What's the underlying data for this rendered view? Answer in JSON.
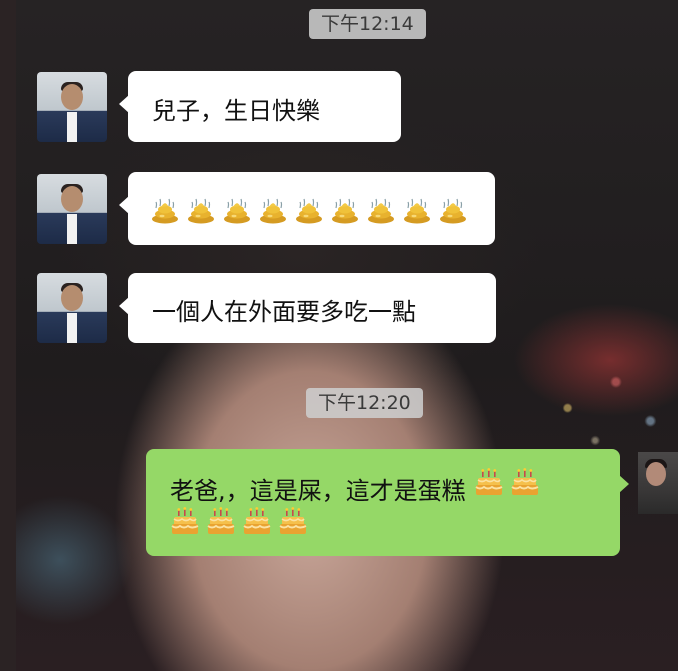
{
  "chat": {
    "timestamps": [
      "下午12:14",
      "下午12:20"
    ],
    "messages": [
      {
        "sender": "father",
        "text": "兒子，生日快樂"
      },
      {
        "sender": "father",
        "emoji": "poop-icon",
        "emoji_count": 9
      },
      {
        "sender": "father",
        "text": "一個人在外面要多吃一點"
      },
      {
        "sender": "son",
        "text": "老爸,，這是屎，這才是蛋糕",
        "emoji": "birthday-cake-icon",
        "emoji_count": 6
      }
    ]
  },
  "colors": {
    "incoming_bubble": "#ffffff",
    "outgoing_bubble": "#95d867",
    "timestamp_bg": "#cdcdcd"
  }
}
